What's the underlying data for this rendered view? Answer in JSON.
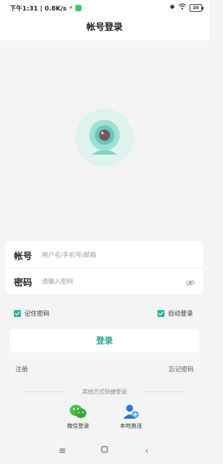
{
  "status_bar": {
    "time_speed": "下午1:31 | 0.8K/s",
    "battery": "20"
  },
  "header": {
    "title": "帐号登录"
  },
  "form": {
    "account_label": "帐号",
    "account_placeholder": "用户名/手机号/邮箱",
    "password_label": "密码",
    "password_placeholder": "请输入密码"
  },
  "options": {
    "remember": "记住密码",
    "auto_login": "自动登录"
  },
  "login_button": "登录",
  "links": {
    "register": "注册",
    "forgot": "忘记密码"
  },
  "other_login": {
    "title": "其他方式快捷登录",
    "wechat": "微信登录",
    "local": "本地直连"
  },
  "colors": {
    "accent": "#26b39c",
    "background": "#f4f4f4"
  },
  "icons": [
    "wifi-icon",
    "bluetooth-icon",
    "camera-icon",
    "eye-icon",
    "wechat-icon",
    "user-add-icon"
  ]
}
